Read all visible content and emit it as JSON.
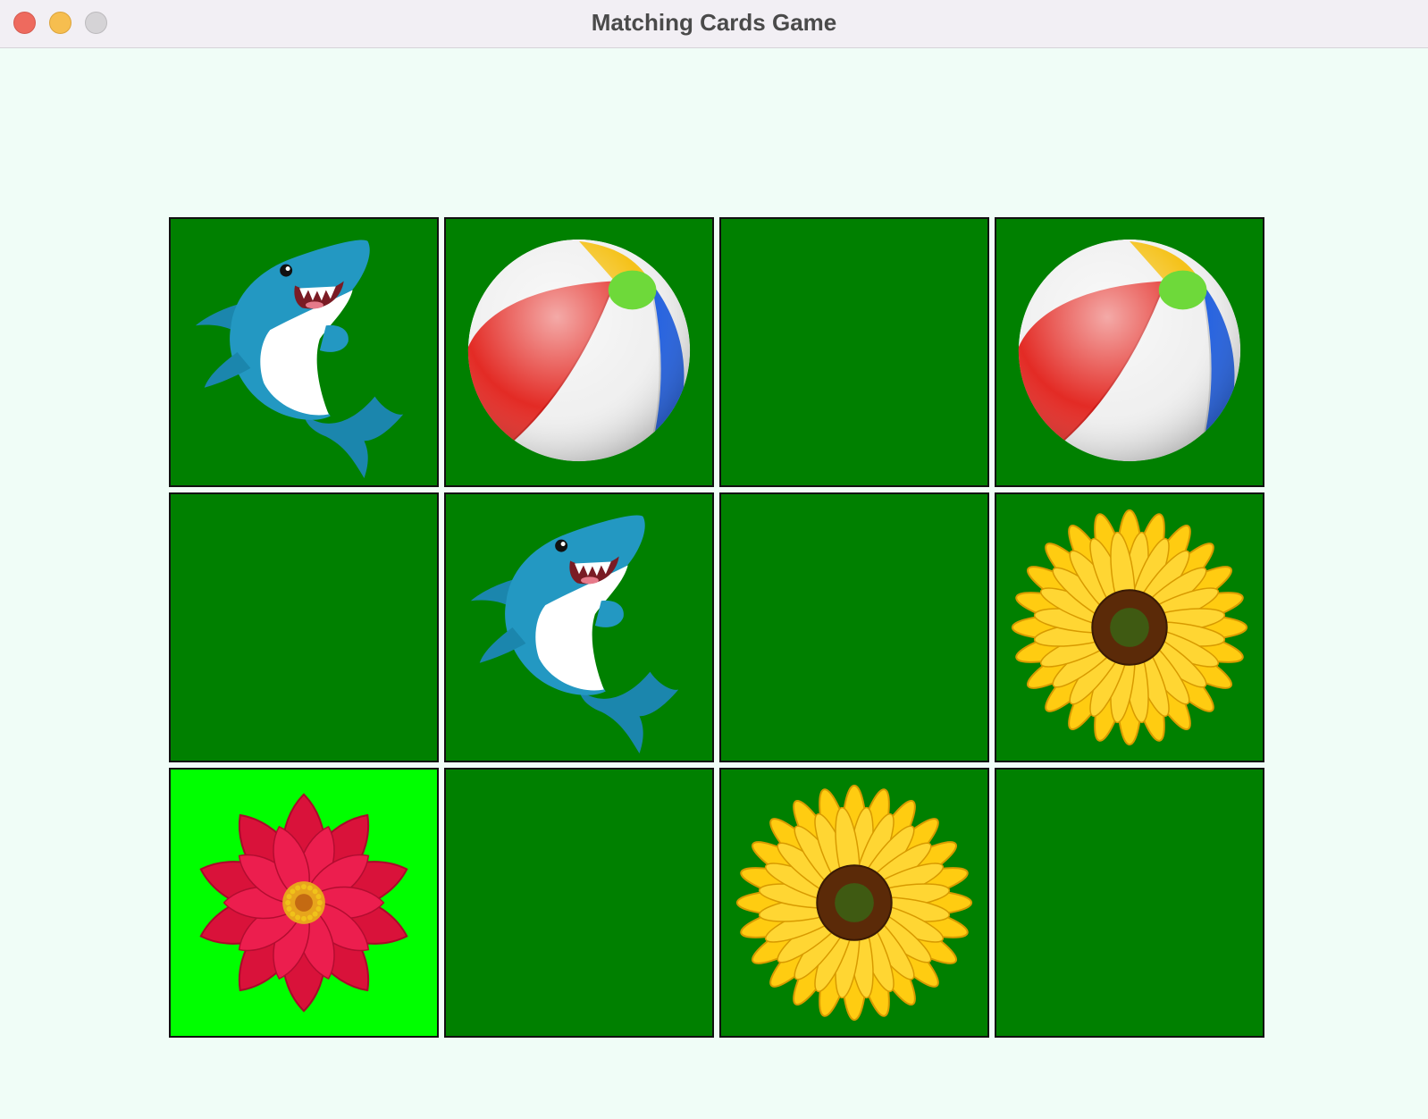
{
  "window": {
    "title": "Matching Cards Game"
  },
  "colors": {
    "background": "#f0fdf7",
    "card_face_down": "#008000",
    "card_selected": "#00ff00",
    "card_border": "#111111"
  },
  "board": {
    "rows": 3,
    "columns": 4,
    "cards": [
      {
        "state": "revealed",
        "picture": "shark-icon"
      },
      {
        "state": "revealed",
        "picture": "beach-ball-icon"
      },
      {
        "state": "hidden",
        "picture": ""
      },
      {
        "state": "revealed",
        "picture": "beach-ball-icon"
      },
      {
        "state": "hidden",
        "picture": ""
      },
      {
        "state": "revealed",
        "picture": "shark-icon"
      },
      {
        "state": "hidden",
        "picture": ""
      },
      {
        "state": "revealed",
        "picture": "sunflower-icon"
      },
      {
        "state": "selected",
        "picture": "red-dahlia-icon"
      },
      {
        "state": "hidden",
        "picture": ""
      },
      {
        "state": "revealed",
        "picture": "sunflower-icon"
      },
      {
        "state": "hidden",
        "picture": ""
      }
    ]
  }
}
